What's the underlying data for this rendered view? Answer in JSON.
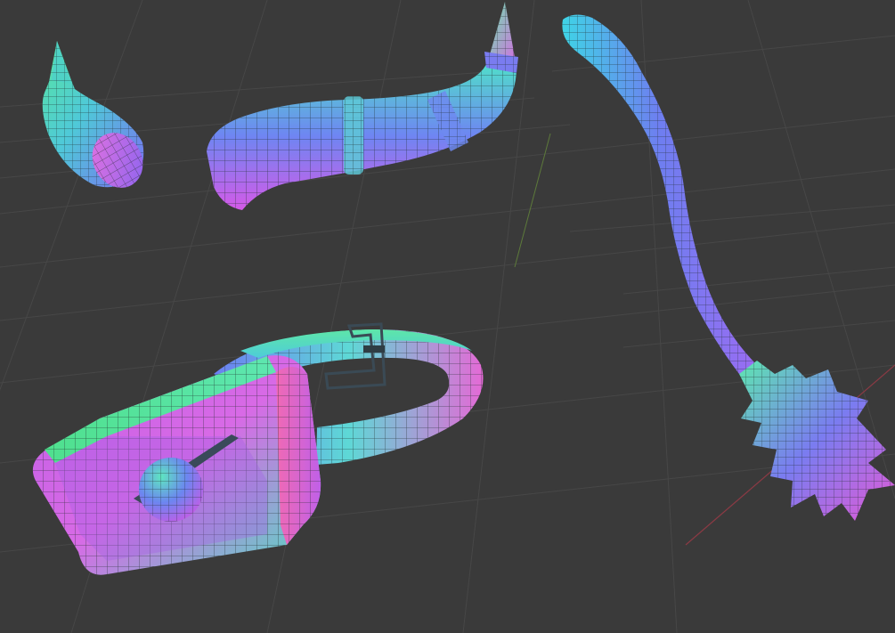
{
  "viewport": {
    "background": "#3a3a3a",
    "grid_color": "#474747",
    "axis_x_color": "#8a3a44",
    "axis_y_color": "#5d7a3a"
  },
  "objects": [
    {
      "name": "small-horn",
      "icon": "horn-mesh"
    },
    {
      "name": "long-horn",
      "icon": "horn-mesh"
    },
    {
      "name": "tail",
      "icon": "tail-mesh"
    },
    {
      "name": "collar",
      "icon": "collar-mesh"
    },
    {
      "name": "bell-box",
      "icon": "box-mesh"
    }
  ],
  "colors": {
    "normal_cyan": "#3ee0c0",
    "normal_green": "#5ee08a",
    "normal_blue": "#6a7cf0",
    "normal_magenta": "#d45ae6",
    "normal_pink": "#f06ac8",
    "wire": "#1e2a2a"
  }
}
